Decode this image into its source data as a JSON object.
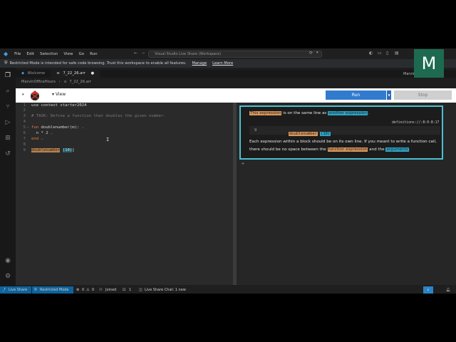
{
  "titlebar": {
    "menu": [
      "File",
      "Edit",
      "Selection",
      "View",
      "Go",
      "Run"
    ],
    "command_center": "Visual Studio Live Share (Workspace)"
  },
  "restricted": {
    "message": "Restricted Mode is intended for safe code browsing. Trust this workspace to enable all features.",
    "manage": "Manage",
    "learn_more": "Learn More"
  },
  "tabs": [
    {
      "label": "Welcome"
    },
    {
      "label": "7_22_26.arr"
    }
  ],
  "breadcrumb": [
    "MarvinOfficeHours",
    "7_22_26.arr"
  ],
  "right_label": "Marvin",
  "avatar_letter": "M",
  "pyret": {
    "view_label": "View",
    "run_label": "Run",
    "stop_label": "Stop"
  },
  "editor": {
    "line_numbers": [
      "1",
      "2",
      "3",
      "4",
      "5",
      "6",
      "7",
      "8",
      "9"
    ],
    "line1": "use context starter2024",
    "line3": "# TASK: Define a function that doubles the given number.",
    "line5_kw": "fun",
    "line5_rest": " doublenumber(m):",
    "line6": "  n * 2",
    "line7_kw": "end",
    "line9_fn": "doublenumber",
    "line9_arg": "(10)"
  },
  "error": {
    "part1": "This expression",
    "part2": " is on the same line as ",
    "part3": "another expression",
    "part4": ".",
    "location": "definitions://:8:0-8:17",
    "snippet_num": "9",
    "snippet_fn": "doublenumber",
    "snippet_arg": "(10)",
    "expl1": "Each expression within a block should be on its own line. If you meant to write a function call,",
    "expl2a": "there should be no space between the ",
    "expl2b": "function expression",
    "expl2c": " and the ",
    "expl2d": "arguments",
    "expl2e": "."
  },
  "prompt": "›››",
  "statusbar": {
    "live_share": "Live Share",
    "restricted": "Restricted Mode",
    "errors": "0",
    "warnings": "0",
    "joined": "Joined",
    "participants": "1",
    "chat": "Live Share Chat: 1 new"
  },
  "colors": {
    "accent": "#317bcf",
    "avatar": "#1e6a50",
    "status": "#0e639c"
  }
}
